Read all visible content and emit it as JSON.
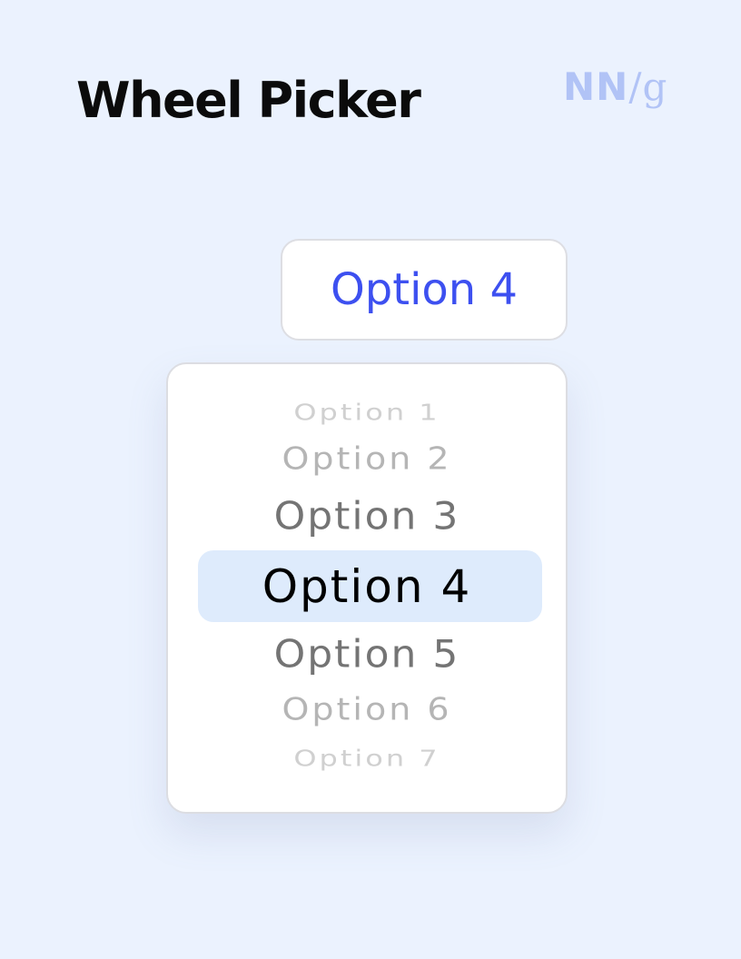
{
  "header": {
    "title": "Wheel Picker",
    "logo": {
      "nn": "NN",
      "slash": "/",
      "g": "g"
    }
  },
  "field": {
    "value": "Option 4"
  },
  "picker": {
    "options": [
      "Option 1",
      "Option 2",
      "Option 3",
      "Option 4",
      "Option 5",
      "Option 6",
      "Option 7"
    ],
    "selected_index": 3
  },
  "colors": {
    "background": "#ebf2fe",
    "accent": "#3d50f0",
    "highlight": "#deebfc",
    "logo": "#b1c3f6"
  }
}
